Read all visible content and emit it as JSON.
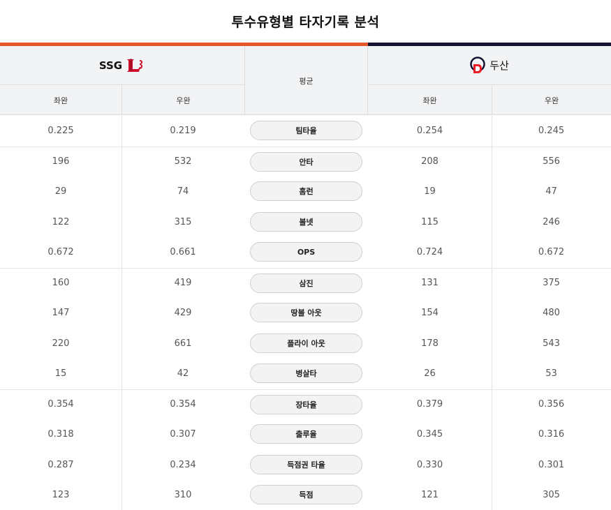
{
  "title": "투수유형별 타자기록 분석",
  "colors": {
    "team_left_accent": "#e3572a",
    "team_right_accent": "#131230"
  },
  "header": {
    "team_left": {
      "name": "SSG",
      "logo": "ssg-landers-logo"
    },
    "team_right": {
      "name": "두산",
      "logo": "doosan-bears-logo"
    },
    "average_label": "평균",
    "sub_columns": [
      "좌완",
      "우완",
      "좌완",
      "우완"
    ]
  },
  "rows": [
    {
      "label": "팀타율",
      "ssg_left": "0.225",
      "ssg_right": "0.219",
      "doosan_left": "0.254",
      "doosan_right": "0.245"
    },
    {
      "label": "안타",
      "ssg_left": "196",
      "ssg_right": "532",
      "doosan_left": "208",
      "doosan_right": "556"
    },
    {
      "label": "홈런",
      "ssg_left": "29",
      "ssg_right": "74",
      "doosan_left": "19",
      "doosan_right": "47"
    },
    {
      "label": "볼넷",
      "ssg_left": "122",
      "ssg_right": "315",
      "doosan_left": "115",
      "doosan_right": "246"
    },
    {
      "label": "OPS",
      "ssg_left": "0.672",
      "ssg_right": "0.661",
      "doosan_left": "0.724",
      "doosan_right": "0.672"
    },
    {
      "label": "삼진",
      "ssg_left": "160",
      "ssg_right": "419",
      "doosan_left": "131",
      "doosan_right": "375"
    },
    {
      "label": "땅볼 아웃",
      "ssg_left": "147",
      "ssg_right": "429",
      "doosan_left": "154",
      "doosan_right": "480"
    },
    {
      "label": "플라이 아웃",
      "ssg_left": "220",
      "ssg_right": "661",
      "doosan_left": "178",
      "doosan_right": "543"
    },
    {
      "label": "병살타",
      "ssg_left": "15",
      "ssg_right": "42",
      "doosan_left": "26",
      "doosan_right": "53"
    },
    {
      "label": "장타율",
      "ssg_left": "0.354",
      "ssg_right": "0.354",
      "doosan_left": "0.379",
      "doosan_right": "0.356"
    },
    {
      "label": "출루율",
      "ssg_left": "0.318",
      "ssg_right": "0.307",
      "doosan_left": "0.345",
      "doosan_right": "0.316"
    },
    {
      "label": "득점권 타율",
      "ssg_left": "0.287",
      "ssg_right": "0.234",
      "doosan_left": "0.330",
      "doosan_right": "0.301"
    },
    {
      "label": "득점",
      "ssg_left": "123",
      "ssg_right": "310",
      "doosan_left": "121",
      "doosan_right": "305"
    }
  ]
}
